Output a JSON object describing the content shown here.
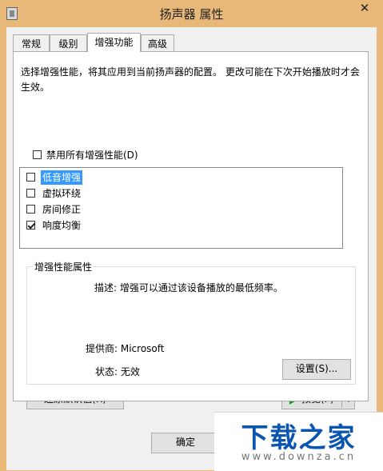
{
  "window": {
    "title": "扬声器 属性",
    "close_glyph": "✕"
  },
  "tabs": [
    {
      "label": "常规"
    },
    {
      "label": "级别"
    },
    {
      "label": "增强功能",
      "active": true
    },
    {
      "label": "高级"
    }
  ],
  "enhancements": {
    "description": "选择增强性能，将其应用到当前扬声器的配置。 更改可能在下次开始播放时才会生效。",
    "disable_all_label": "禁用所有增强性能(D)",
    "disable_all_checked": false,
    "items": [
      {
        "label": "低音增强",
        "checked": false,
        "selected": true
      },
      {
        "label": "虚拟环绕",
        "checked": false
      },
      {
        "label": "房间修正",
        "checked": false
      },
      {
        "label": "响度均衡",
        "checked": true
      }
    ]
  },
  "properties": {
    "group_title": "增强性能属性",
    "description": "描述: 增强可以通过该设备播放的最低频率。",
    "provider": "提供商: Microsoft",
    "status": "状态: 无效",
    "settings_button": "设置(S)..."
  },
  "bottom": {
    "restore_defaults_button": "还原默认值(R)",
    "preview_button": "预览(P)",
    "ok_button": "确定",
    "play_icon_color": "#1f9a1f"
  },
  "watermark": {
    "main": "下载之家",
    "sub": "www.downza.cn"
  }
}
